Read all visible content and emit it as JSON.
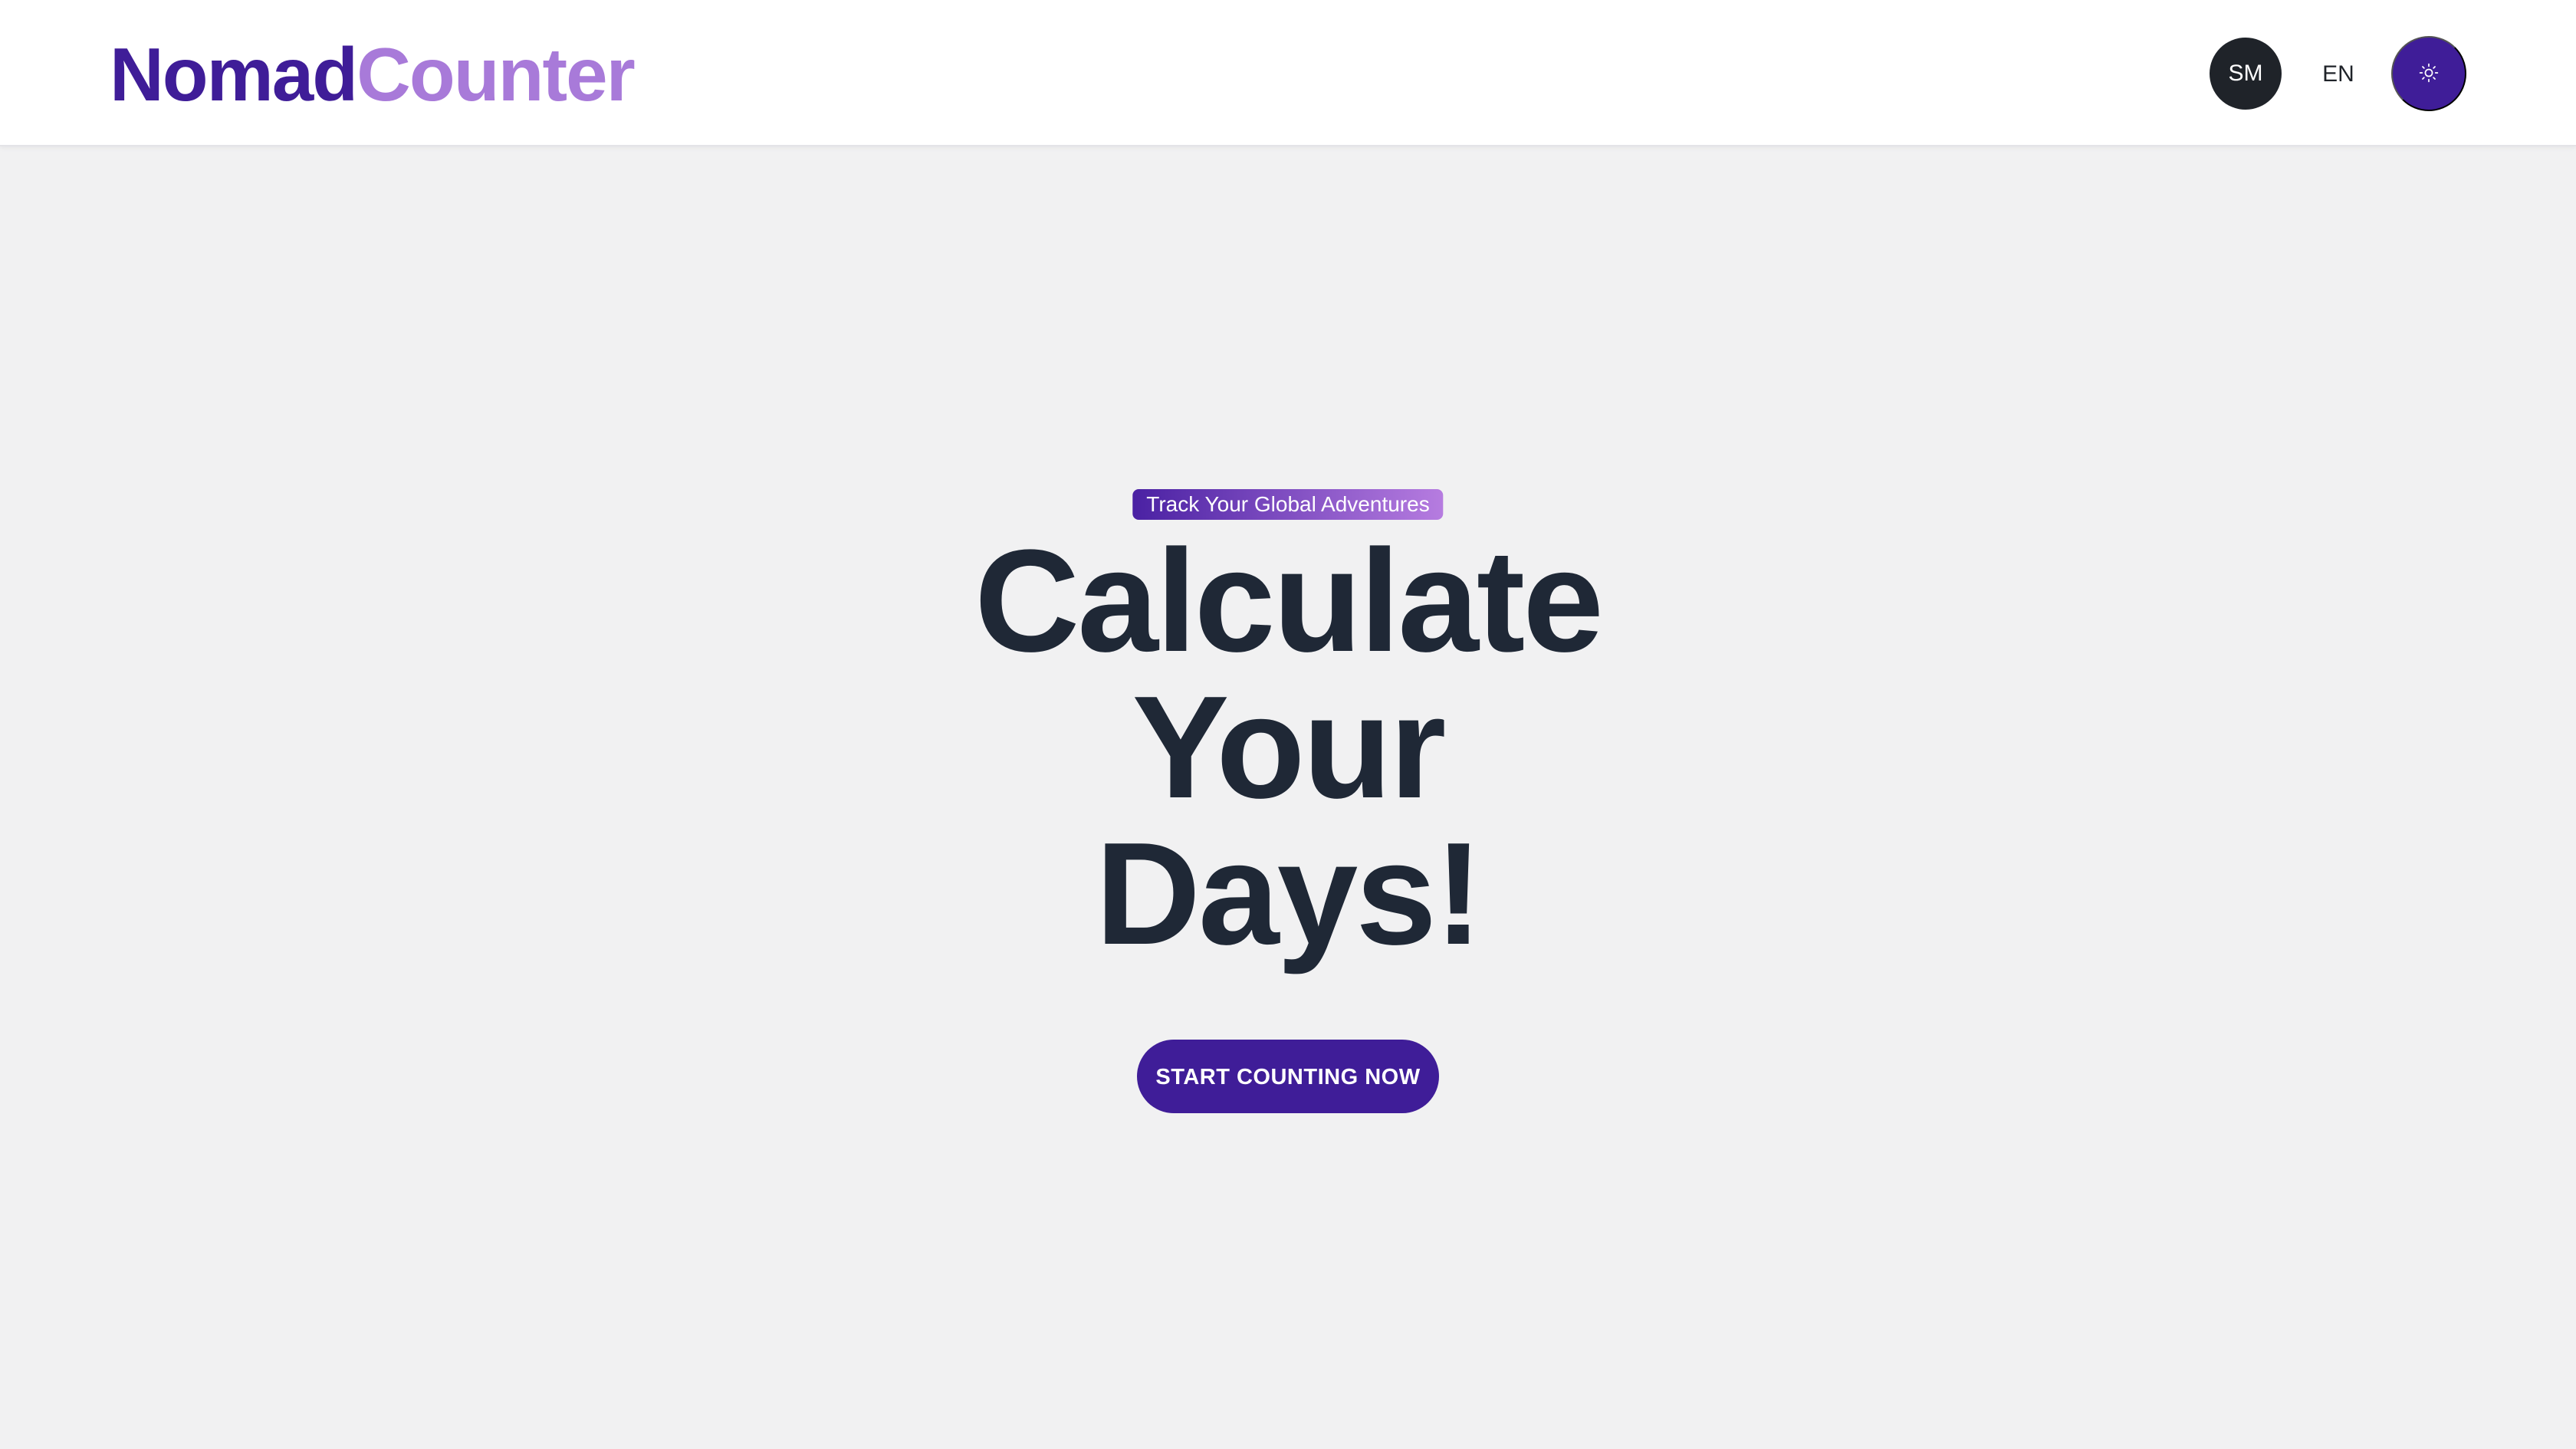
{
  "header": {
    "logo_part1": "Nomad",
    "logo_part2": "Counter",
    "avatar_initials": "SM",
    "language": "EN",
    "theme_icon": "sun-icon"
  },
  "hero": {
    "badge": "Track Your Global Adventures",
    "title_line1": "Calculate",
    "title_line2": "Your",
    "title_line3": "Days!",
    "cta_label": "START COUNTING NOW"
  },
  "colors": {
    "brand_primary": "#3f1d98",
    "brand_secondary": "#a87ad9",
    "background": "#f1f1f2",
    "text_dark": "#1f2836"
  }
}
